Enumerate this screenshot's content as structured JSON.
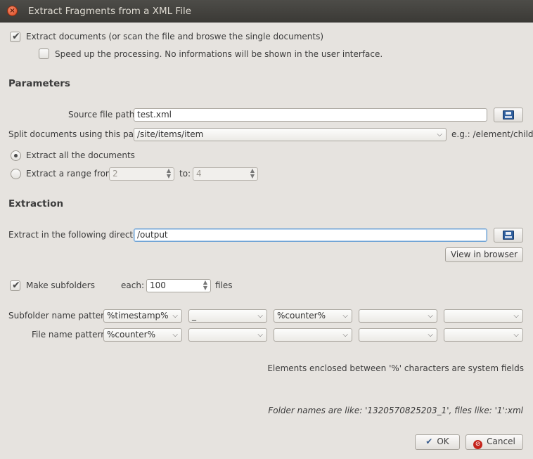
{
  "window": {
    "title": "Extract Fragments from a XML File"
  },
  "options": {
    "extract_documents_label": "Extract documents (or scan the file and broswe the single documents)",
    "speed_up_label": "Speed up the processing. No informations will be shown in the user interface."
  },
  "parameters": {
    "heading": "Parameters",
    "source_label": "Source file path:",
    "source_value": "test.xml",
    "split_label": "Split documents using this path",
    "split_value": "/site/items/item",
    "split_hint": "e.g.: /element/child",
    "extract_all_label": "Extract all the documents",
    "extract_range_label": "Extract a range from:",
    "range_from": "2",
    "range_to_label": "to:",
    "range_to": "4"
  },
  "extraction": {
    "heading": "Extraction",
    "dir_label": "Extract in the following directory:",
    "dir_value": "/output",
    "view_browser_label": "View in browser",
    "make_subfolders_label": "Make subfolders",
    "each_label": "each:",
    "each_value": "100",
    "files_label": "files",
    "subfolder_pattern_label": "Subfolder name pattern",
    "subfolder_pattern": [
      "%timestamp%",
      "_",
      "%counter%",
      "",
      ""
    ],
    "file_pattern_label": "File name pattern",
    "file_pattern": [
      "%counter%",
      "",
      "",
      "",
      ""
    ],
    "system_fields_note": "Elements enclosed between '%' characters are system fields",
    "names_preview": "Folder names are like: '1320570825203_1', files like: '1':xml"
  },
  "buttons": {
    "ok": "OK",
    "cancel": "Cancel"
  },
  "icons": [
    "close-icon",
    "save-icon",
    "checkmark-icon",
    "cancel-icon",
    "chevron-down-icon",
    "spin-arrows-icon"
  ]
}
